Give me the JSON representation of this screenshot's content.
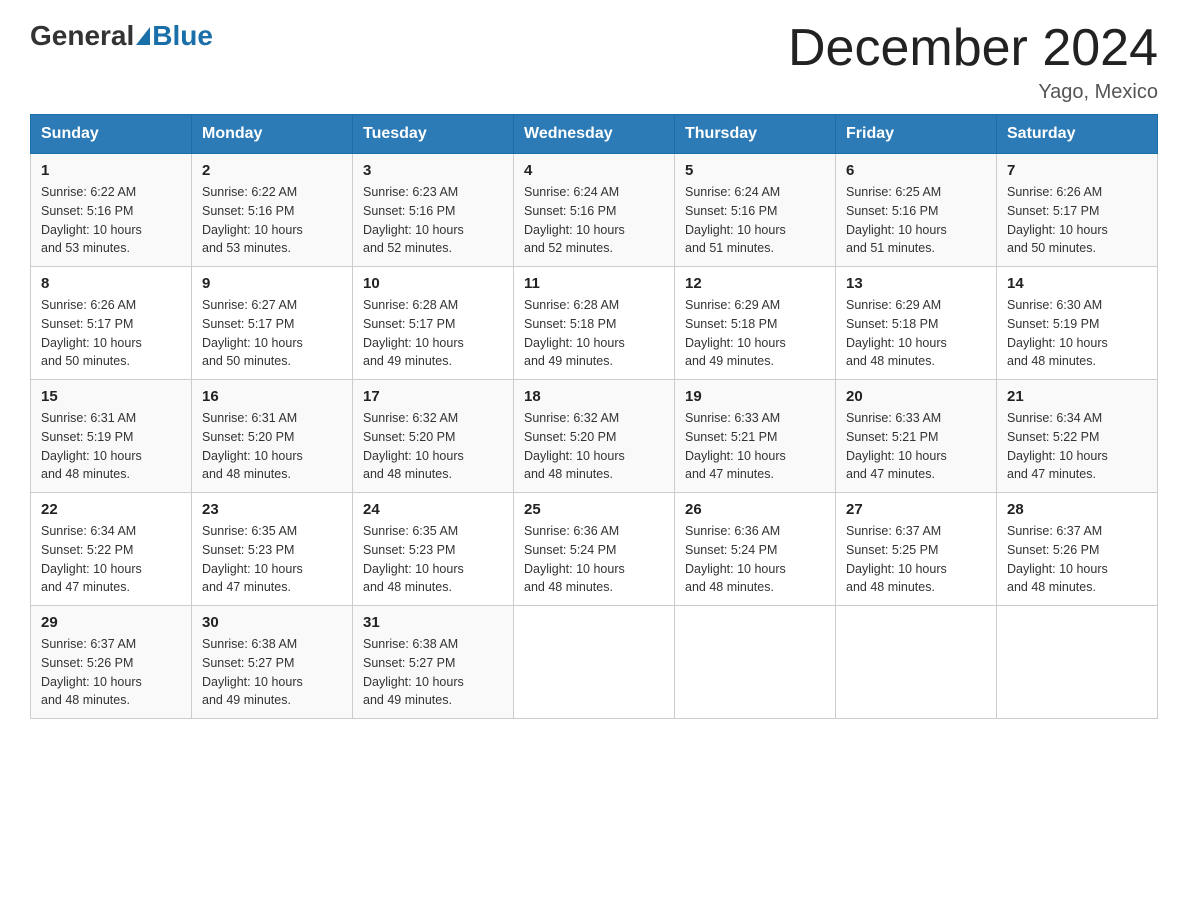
{
  "header": {
    "logo_general": "General",
    "logo_blue": "Blue",
    "month_title": "December 2024",
    "location": "Yago, Mexico"
  },
  "weekdays": [
    "Sunday",
    "Monday",
    "Tuesday",
    "Wednesday",
    "Thursday",
    "Friday",
    "Saturday"
  ],
  "weeks": [
    [
      {
        "day": "1",
        "sunrise": "6:22 AM",
        "sunset": "5:16 PM",
        "daylight": "10 hours and 53 minutes."
      },
      {
        "day": "2",
        "sunrise": "6:22 AM",
        "sunset": "5:16 PM",
        "daylight": "10 hours and 53 minutes."
      },
      {
        "day": "3",
        "sunrise": "6:23 AM",
        "sunset": "5:16 PM",
        "daylight": "10 hours and 52 minutes."
      },
      {
        "day": "4",
        "sunrise": "6:24 AM",
        "sunset": "5:16 PM",
        "daylight": "10 hours and 52 minutes."
      },
      {
        "day": "5",
        "sunrise": "6:24 AM",
        "sunset": "5:16 PM",
        "daylight": "10 hours and 51 minutes."
      },
      {
        "day": "6",
        "sunrise": "6:25 AM",
        "sunset": "5:16 PM",
        "daylight": "10 hours and 51 minutes."
      },
      {
        "day": "7",
        "sunrise": "6:26 AM",
        "sunset": "5:17 PM",
        "daylight": "10 hours and 50 minutes."
      }
    ],
    [
      {
        "day": "8",
        "sunrise": "6:26 AM",
        "sunset": "5:17 PM",
        "daylight": "10 hours and 50 minutes."
      },
      {
        "day": "9",
        "sunrise": "6:27 AM",
        "sunset": "5:17 PM",
        "daylight": "10 hours and 50 minutes."
      },
      {
        "day": "10",
        "sunrise": "6:28 AM",
        "sunset": "5:17 PM",
        "daylight": "10 hours and 49 minutes."
      },
      {
        "day": "11",
        "sunrise": "6:28 AM",
        "sunset": "5:18 PM",
        "daylight": "10 hours and 49 minutes."
      },
      {
        "day": "12",
        "sunrise": "6:29 AM",
        "sunset": "5:18 PM",
        "daylight": "10 hours and 49 minutes."
      },
      {
        "day": "13",
        "sunrise": "6:29 AM",
        "sunset": "5:18 PM",
        "daylight": "10 hours and 48 minutes."
      },
      {
        "day": "14",
        "sunrise": "6:30 AM",
        "sunset": "5:19 PM",
        "daylight": "10 hours and 48 minutes."
      }
    ],
    [
      {
        "day": "15",
        "sunrise": "6:31 AM",
        "sunset": "5:19 PM",
        "daylight": "10 hours and 48 minutes."
      },
      {
        "day": "16",
        "sunrise": "6:31 AM",
        "sunset": "5:20 PM",
        "daylight": "10 hours and 48 minutes."
      },
      {
        "day": "17",
        "sunrise": "6:32 AM",
        "sunset": "5:20 PM",
        "daylight": "10 hours and 48 minutes."
      },
      {
        "day": "18",
        "sunrise": "6:32 AM",
        "sunset": "5:20 PM",
        "daylight": "10 hours and 48 minutes."
      },
      {
        "day": "19",
        "sunrise": "6:33 AM",
        "sunset": "5:21 PM",
        "daylight": "10 hours and 47 minutes."
      },
      {
        "day": "20",
        "sunrise": "6:33 AM",
        "sunset": "5:21 PM",
        "daylight": "10 hours and 47 minutes."
      },
      {
        "day": "21",
        "sunrise": "6:34 AM",
        "sunset": "5:22 PM",
        "daylight": "10 hours and 47 minutes."
      }
    ],
    [
      {
        "day": "22",
        "sunrise": "6:34 AM",
        "sunset": "5:22 PM",
        "daylight": "10 hours and 47 minutes."
      },
      {
        "day": "23",
        "sunrise": "6:35 AM",
        "sunset": "5:23 PM",
        "daylight": "10 hours and 47 minutes."
      },
      {
        "day": "24",
        "sunrise": "6:35 AM",
        "sunset": "5:23 PM",
        "daylight": "10 hours and 48 minutes."
      },
      {
        "day": "25",
        "sunrise": "6:36 AM",
        "sunset": "5:24 PM",
        "daylight": "10 hours and 48 minutes."
      },
      {
        "day": "26",
        "sunrise": "6:36 AM",
        "sunset": "5:24 PM",
        "daylight": "10 hours and 48 minutes."
      },
      {
        "day": "27",
        "sunrise": "6:37 AM",
        "sunset": "5:25 PM",
        "daylight": "10 hours and 48 minutes."
      },
      {
        "day": "28",
        "sunrise": "6:37 AM",
        "sunset": "5:26 PM",
        "daylight": "10 hours and 48 minutes."
      }
    ],
    [
      {
        "day": "29",
        "sunrise": "6:37 AM",
        "sunset": "5:26 PM",
        "daylight": "10 hours and 48 minutes."
      },
      {
        "day": "30",
        "sunrise": "6:38 AM",
        "sunset": "5:27 PM",
        "daylight": "10 hours and 49 minutes."
      },
      {
        "day": "31",
        "sunrise": "6:38 AM",
        "sunset": "5:27 PM",
        "daylight": "10 hours and 49 minutes."
      },
      null,
      null,
      null,
      null
    ]
  ],
  "labels": {
    "sunrise": "Sunrise:",
    "sunset": "Sunset:",
    "daylight": "Daylight:"
  }
}
